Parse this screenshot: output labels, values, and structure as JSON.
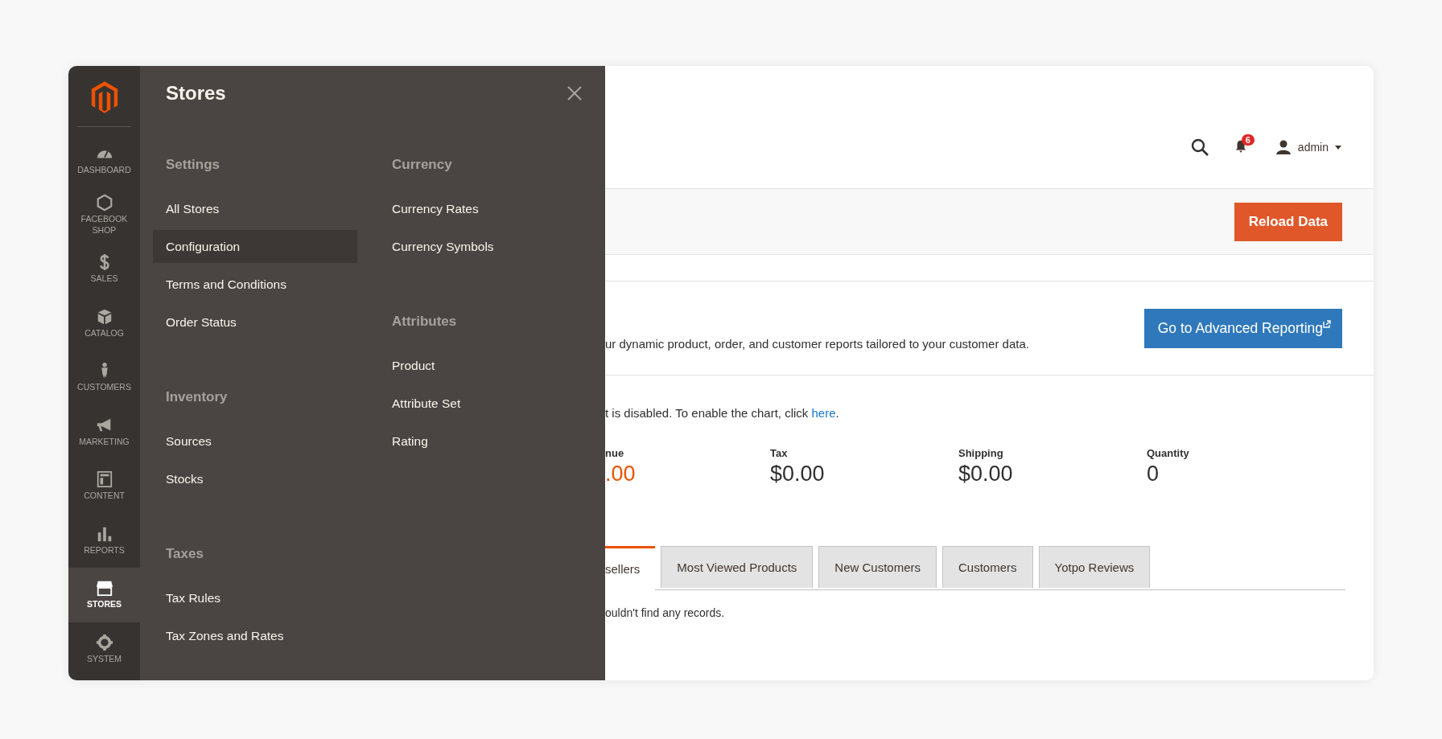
{
  "sidebar": {
    "items": [
      {
        "label": "DASHBOARD",
        "selected": false
      },
      {
        "label": "FACEBOOK SHOP",
        "selected": false
      },
      {
        "label": "SALES",
        "selected": false
      },
      {
        "label": "CATALOG",
        "selected": false
      },
      {
        "label": "CUSTOMERS",
        "selected": false
      },
      {
        "label": "MARKETING",
        "selected": false
      },
      {
        "label": "CONTENT",
        "selected": false
      },
      {
        "label": "REPORTS",
        "selected": false
      },
      {
        "label": "STORES",
        "selected": true
      },
      {
        "label": "SYSTEM",
        "selected": false
      }
    ]
  },
  "flyout": {
    "title": "Stores",
    "columns": [
      {
        "groups": [
          {
            "heading": "Settings",
            "items": [
              {
                "label": "All Stores",
                "selected": false
              },
              {
                "label": "Configuration",
                "selected": true
              },
              {
                "label": "Terms and Conditions",
                "selected": false
              },
              {
                "label": "Order Status",
                "selected": false
              }
            ]
          },
          {
            "heading": "Inventory",
            "items": [
              {
                "label": "Sources",
                "selected": false
              },
              {
                "label": "Stocks",
                "selected": false
              }
            ]
          },
          {
            "heading": "Taxes",
            "items": [
              {
                "label": "Tax Rules",
                "selected": false
              },
              {
                "label": "Tax Zones and Rates",
                "selected": false
              }
            ]
          }
        ]
      },
      {
        "groups": [
          {
            "heading": "Currency",
            "items": [
              {
                "label": "Currency Rates",
                "selected": false
              },
              {
                "label": "Currency Symbols",
                "selected": false
              }
            ]
          },
          {
            "heading": "Attributes",
            "items": [
              {
                "label": "Product",
                "selected": false
              },
              {
                "label": "Attribute Set",
                "selected": false
              },
              {
                "label": "Rating",
                "selected": false
              }
            ]
          }
        ]
      }
    ]
  },
  "header": {
    "notifications": "6",
    "user": "admin"
  },
  "reload_button": "Reload Data",
  "advanced_reporting": {
    "text": "ur dynamic product, order, and customer reports tailored to your customer data.",
    "button": "Go to Advanced Reporting"
  },
  "chart_notice": {
    "text": "t is disabled. To enable the chart, click ",
    "link": "here",
    "after": "."
  },
  "stats": [
    {
      "label": "nue",
      "value": ".00",
      "emphasis": true
    },
    {
      "label": "Tax",
      "value": "$0.00",
      "emphasis": false
    },
    {
      "label": "Shipping",
      "value": "$0.00",
      "emphasis": false
    },
    {
      "label": "Quantity",
      "value": "0",
      "emphasis": false
    }
  ],
  "tabs": [
    {
      "label": "sellers",
      "selected": true
    },
    {
      "label": "Most Viewed Products",
      "selected": false
    },
    {
      "label": "New Customers",
      "selected": false
    },
    {
      "label": "Customers",
      "selected": false
    },
    {
      "label": "Yotpo Reviews",
      "selected": false
    }
  ],
  "empty_message": "ouldn't find any records."
}
